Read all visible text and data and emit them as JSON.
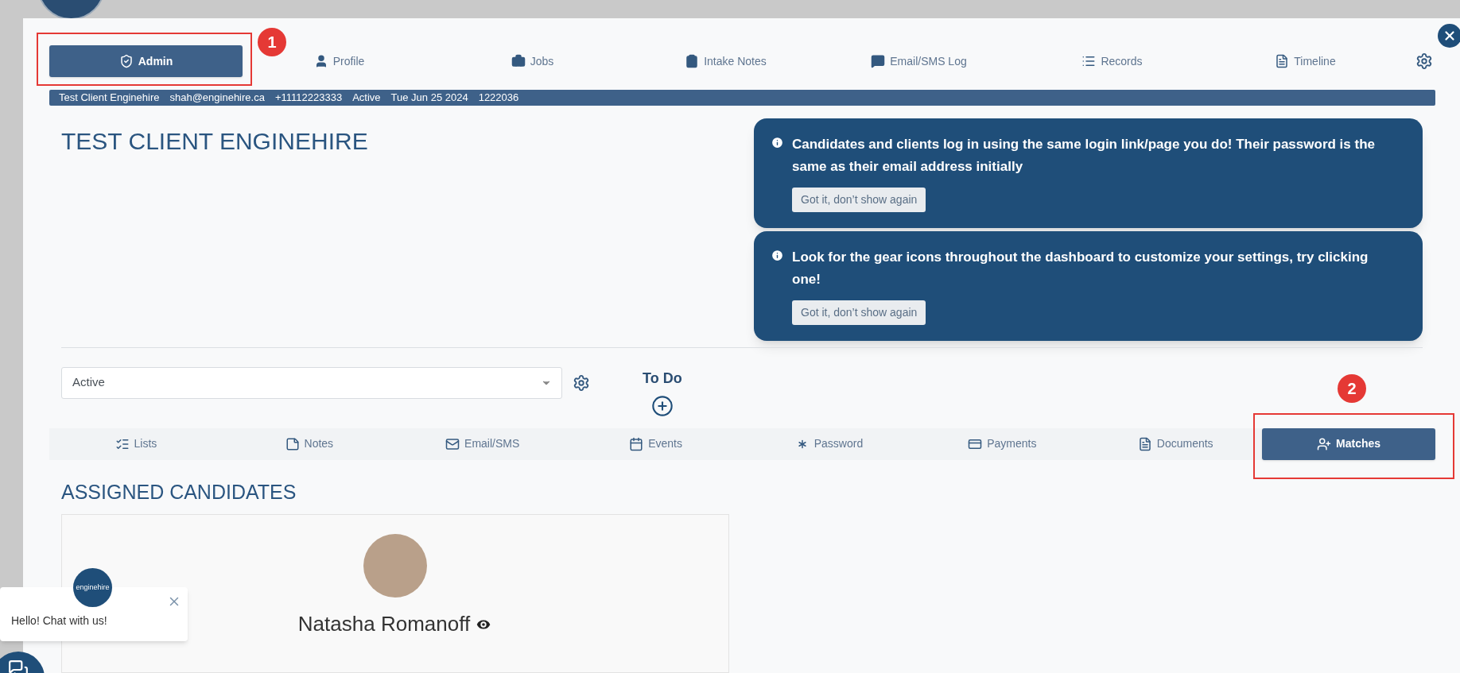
{
  "top_tabs": [
    {
      "label": "Admin",
      "selected": true,
      "annotation": "1"
    },
    {
      "label": "Profile",
      "selected": false
    },
    {
      "label": "Jobs",
      "selected": false
    },
    {
      "label": "Intake Notes",
      "selected": false
    },
    {
      "label": "Email/SMS Log",
      "selected": false
    },
    {
      "label": "Records",
      "selected": false
    },
    {
      "label": "Timeline",
      "selected": false
    }
  ],
  "info_bar": [
    "Test Client Enginehire",
    "shah@enginehire.ca",
    "+11112223333",
    "Active",
    "Tue Jun 25 2024",
    "1222036"
  ],
  "title": "TEST CLIENT ENGINEHIRE",
  "notifications": [
    {
      "message": "Candidates and clients log in using the same login link/page you do! Their password is the same as their email address initially",
      "button": "Got it, don’t show again"
    },
    {
      "message": "Look for the gear icons throughout the dashboard to customize your settings, try clicking one!",
      "button": "Got it, don’t show again"
    }
  ],
  "status_select": {
    "value": "Active"
  },
  "todo": {
    "label": "To Do"
  },
  "section_tabs": [
    {
      "label": "Lists",
      "selected": false
    },
    {
      "label": "Notes",
      "selected": false
    },
    {
      "label": "Email/SMS",
      "selected": false
    },
    {
      "label": "Events",
      "selected": false
    },
    {
      "label": "Password",
      "selected": false
    },
    {
      "label": "Payments",
      "selected": false
    },
    {
      "label": "Documents",
      "selected": false
    },
    {
      "label": "Matches",
      "selected": true,
      "annotation": "2"
    }
  ],
  "section_title": "ASSIGNED CANDIDATES",
  "candidates": [
    {
      "name": "Natasha Romanoff"
    }
  ],
  "chat": {
    "logo_text": "enginehire",
    "message": "Hello! Chat with us!"
  }
}
